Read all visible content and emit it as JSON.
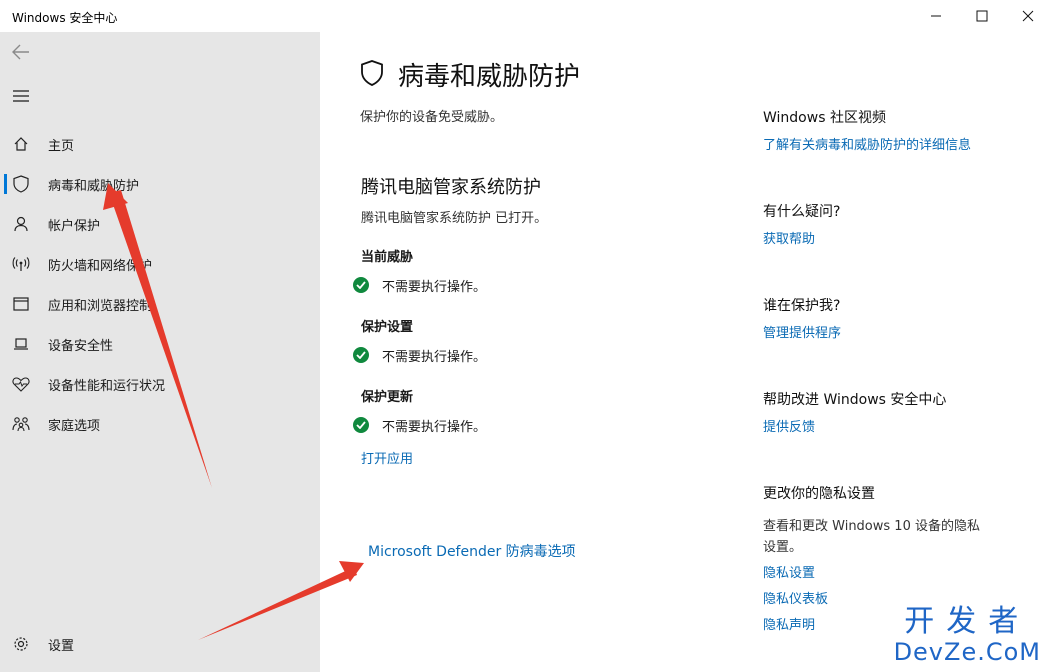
{
  "window": {
    "title": "Windows 安全中心"
  },
  "sidebar": {
    "items": [
      {
        "label": "主页",
        "icon": "home-icon"
      },
      {
        "label": "病毒和威胁防护",
        "icon": "shield-icon",
        "selected": true
      },
      {
        "label": "帐户保护",
        "icon": "person-icon"
      },
      {
        "label": "防火墙和网络保护",
        "icon": "antenna-icon"
      },
      {
        "label": "应用和浏览器控制",
        "icon": "app-window-icon"
      },
      {
        "label": "设备安全性",
        "icon": "laptop-icon"
      },
      {
        "label": "设备性能和运行状况",
        "icon": "heart-icon"
      },
      {
        "label": "家庭选项",
        "icon": "family-icon"
      }
    ],
    "settings_label": "设置"
  },
  "main": {
    "title": "病毒和威胁防护",
    "subtitle": "保护你的设备免受威胁。",
    "provider": {
      "title": "腾讯电脑管家系统防护",
      "status": "腾讯电脑管家系统防护 已打开。"
    },
    "sections": [
      {
        "heading": "当前威胁",
        "status": "不需要执行操作。"
      },
      {
        "heading": "保护设置",
        "status": "不需要执行操作。"
      },
      {
        "heading": "保护更新",
        "status": "不需要执行操作。"
      }
    ],
    "open_app_link": "打开应用",
    "defender_link": "Microsoft Defender 防病毒选项"
  },
  "right_panel": {
    "community": {
      "heading": "Windows 社区视频",
      "link": "了解有关病毒和威胁防护的详细信息"
    },
    "question": {
      "heading": "有什么疑问?",
      "link": "获取帮助"
    },
    "who": {
      "heading": "谁在保护我?",
      "link": "管理提供程序"
    },
    "improve": {
      "heading": "帮助改进 Windows 安全中心",
      "link": "提供反馈"
    },
    "privacy": {
      "heading": "更改你的隐私设置",
      "text_line1": "查看和更改 Windows 10 设备的隐私",
      "text_line2": "设置。",
      "links": [
        "隐私设置",
        "隐私仪表板",
        "隐私声明"
      ]
    }
  },
  "watermark": {
    "cn": "开发者",
    "en": "DevZe.CoM"
  },
  "colors": {
    "accent": "#0078d7",
    "link": "#0a6ab4",
    "ok_green": "#10893e",
    "annotation_red": "#e53b2c"
  }
}
